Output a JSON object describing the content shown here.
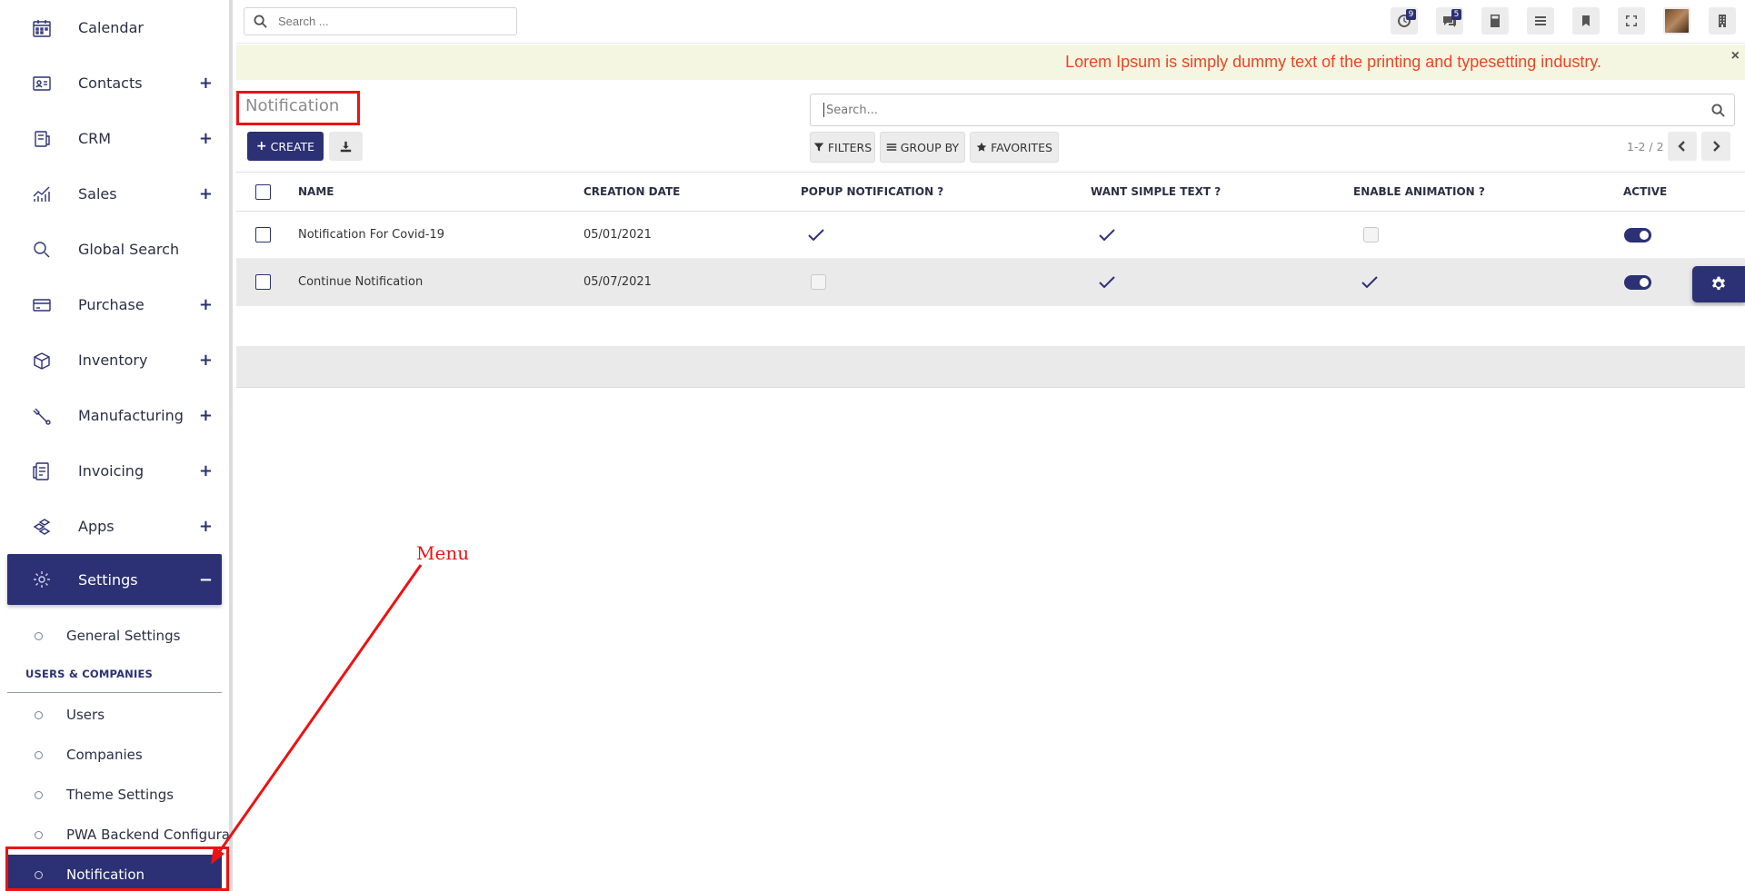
{
  "sidebar": {
    "items": [
      {
        "label": "Calendar",
        "icon": "calendar-icon",
        "plus": ""
      },
      {
        "label": "Contacts",
        "icon": "contacts-icon",
        "plus": "+"
      },
      {
        "label": "CRM",
        "icon": "crm-icon",
        "plus": "+"
      },
      {
        "label": "Sales",
        "icon": "sales-chart-icon",
        "plus": "+"
      },
      {
        "label": "Global Search",
        "icon": "search-icon",
        "plus": ""
      },
      {
        "label": "Purchase",
        "icon": "credit-card-icon",
        "plus": "+"
      },
      {
        "label": "Inventory",
        "icon": "box-icon",
        "plus": "+"
      },
      {
        "label": "Manufacturing",
        "icon": "wrench-icon",
        "plus": "+"
      },
      {
        "label": "Invoicing",
        "icon": "invoice-icon",
        "plus": "+"
      },
      {
        "label": "Apps",
        "icon": "apps-icon",
        "plus": "+"
      }
    ],
    "active": {
      "label": "Settings",
      "icon": "gear-icon",
      "toggle": "−"
    },
    "sub_general": "General Settings",
    "sub_header": "USERS & COMPANIES",
    "sub_items": [
      "Users",
      "Companies",
      "Theme Settings",
      "PWA Backend Configurat"
    ],
    "sub_active": "Notification"
  },
  "topbar": {
    "search_placeholder": "Search ...",
    "activity_badge": "9",
    "messages_badge": "5"
  },
  "banner": {
    "text": "Lorem Ipsum is simply dummy text of the printing and typesetting industry.",
    "close": "×"
  },
  "control": {
    "title": "Notification",
    "create_label": "CREATE",
    "create_plus": "+",
    "search_placeholder": "Search...",
    "filters_label": "FILTERS",
    "groupby_label": "GROUP BY",
    "favorites_label": "FAVORITES",
    "pager": "1-2 / 2"
  },
  "table": {
    "columns": [
      "NAME",
      "CREATION DATE",
      "POPUP NOTIFICATION ?",
      "WANT SIMPLE TEXT ?",
      "ENABLE ANIMATION ?",
      "ACTIVE"
    ],
    "rows": [
      {
        "name": "Notification For Covid-19",
        "date": "05/01/2021",
        "popup": true,
        "simple": true,
        "animation": false,
        "active": true
      },
      {
        "name": "Continue Notification",
        "date": "05/07/2021",
        "popup": false,
        "simple": true,
        "animation": true,
        "active": true
      }
    ]
  },
  "annotation": {
    "label": "Menu"
  },
  "colors": {
    "primary": "#2b3174",
    "banner_text": "#ee4422",
    "annotation": "#ee1111"
  }
}
